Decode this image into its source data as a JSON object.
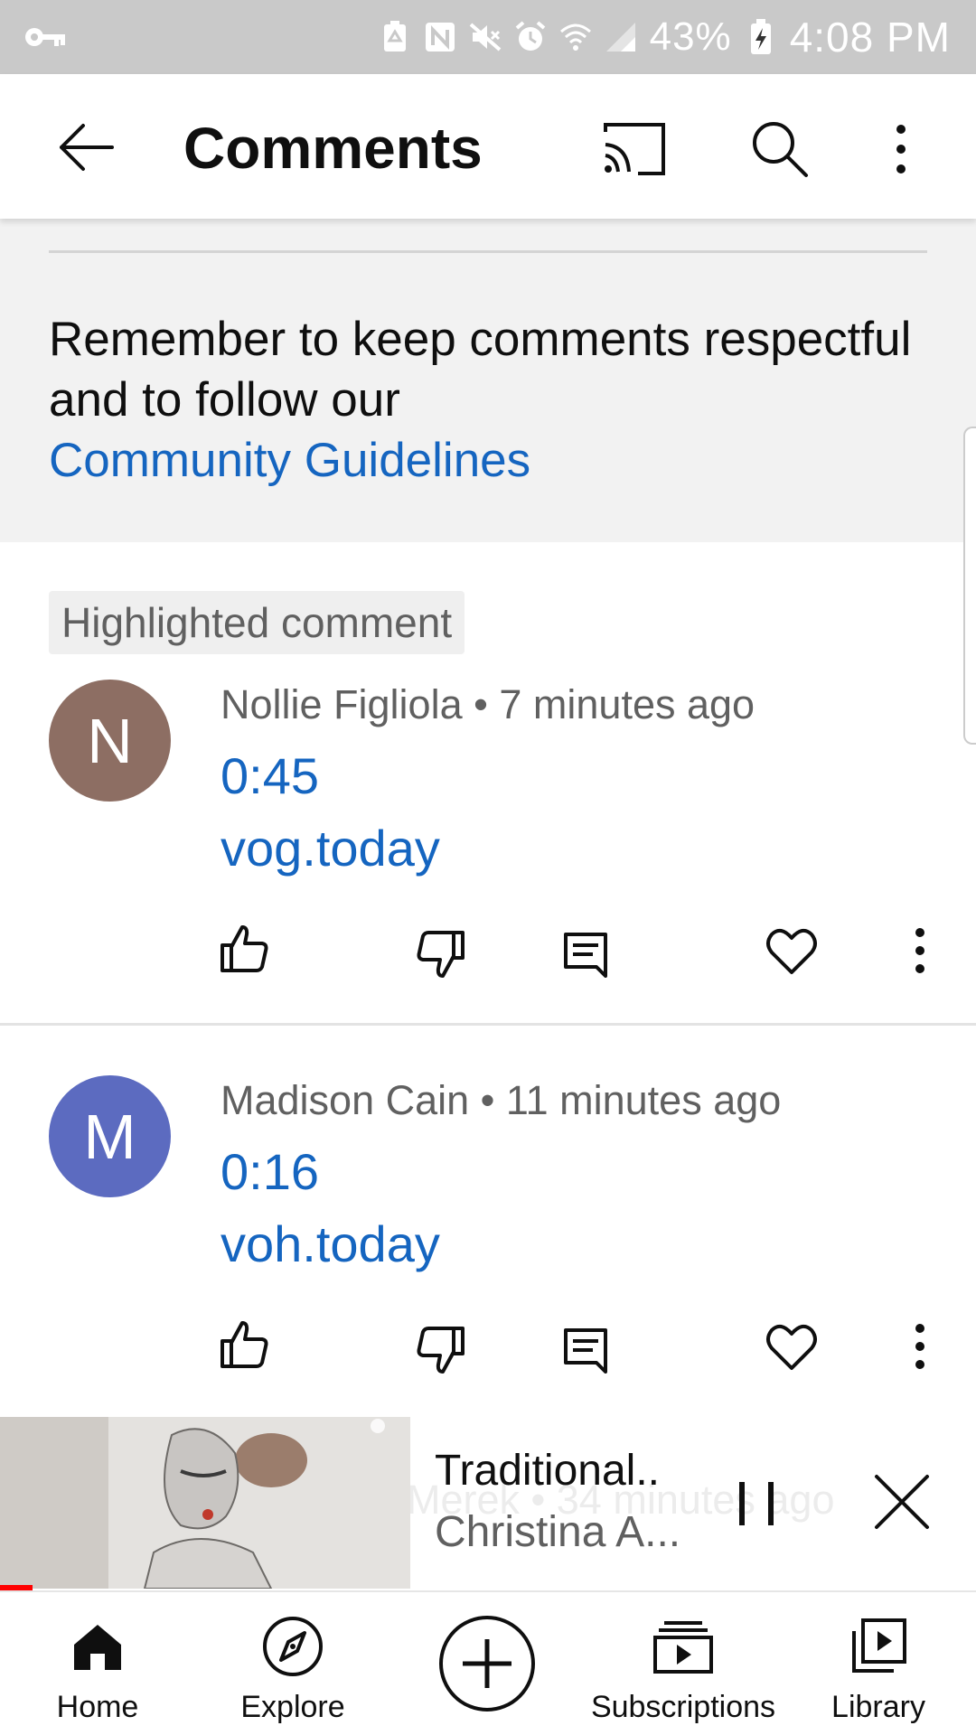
{
  "status_bar": {
    "battery_percent": "43%",
    "time": "4:08 PM",
    "icons": [
      "key-icon",
      "battery-saver-icon",
      "nfc-icon",
      "mute-icon",
      "alarm-icon",
      "wifi-icon",
      "signal-icon",
      "battery-charging-icon"
    ]
  },
  "header": {
    "title": "Comments",
    "icons": [
      "back-arrow-icon",
      "cast-icon",
      "search-icon",
      "more-vert-icon"
    ]
  },
  "guidelines": {
    "text": "Remember to keep comments respectful and to follow our",
    "link": "Community Guidelines"
  },
  "highlight_badge": "Highlighted comment",
  "comments": [
    {
      "author": "Nollie Figliola",
      "time": "7 minutes ago",
      "initial": "N",
      "avatar_color": "#8d6e63",
      "timestamp": "0:45",
      "link": "vog.today"
    },
    {
      "author": "Madison Cain",
      "time": "11 minutes ago",
      "initial": "M",
      "avatar_color": "#5c6bc0",
      "timestamp": "0:16",
      "link": "voh.today"
    }
  ],
  "partial_comment": "Merek • 34 minutes ago",
  "mini_player": {
    "title": "Traditional..",
    "channel": "Christina A...",
    "progress_fraction": 0.08
  },
  "nav": {
    "items": [
      {
        "label": "Home",
        "icon": "home-icon"
      },
      {
        "label": "Explore",
        "icon": "explore-icon"
      },
      {
        "label": "",
        "icon": "create-icon"
      },
      {
        "label": "Subscriptions",
        "icon": "subscriptions-icon"
      },
      {
        "label": "Library",
        "icon": "library-icon"
      }
    ]
  },
  "colors": {
    "link": "#1565c0",
    "progress": "#ff0000",
    "banner_bg": "#f2f2f2",
    "status_bar_bg": "#c9c9c9"
  }
}
